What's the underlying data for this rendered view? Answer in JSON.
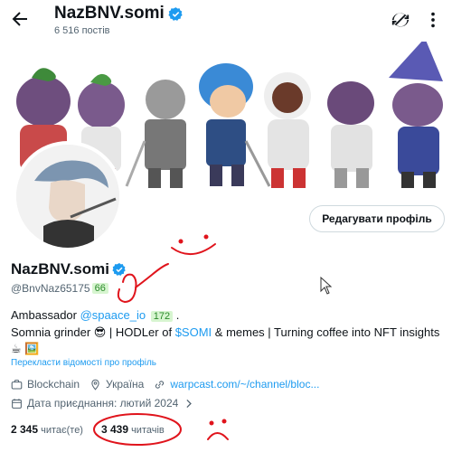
{
  "header": {
    "name": "NazBNV.somi",
    "post_count": "6 516 постів",
    "back_icon": "arrow-left-icon",
    "refresh_icon": "refresh-icon",
    "more_icon": "more-vertical-icon"
  },
  "profile": {
    "name": "NazBNV.somi",
    "handle": "@BnvNaz65175",
    "handle_badge": "66",
    "edit_button": "Редагувати профіль",
    "bio": {
      "role": "Ambassador",
      "mention": "@spaace_io",
      "mention_badge": "172",
      "mention_after": ".",
      "line2_start": "Somnia grinder 😎 | HODLer of",
      "cashtag": "$SOMI",
      "line2_end": "& memes | Turning coffee into NFT insights",
      "line3": "☕ 🖼️"
    },
    "translate_link": "Перекласти відомості про профіль",
    "category": "Blockchain",
    "location": "Україна",
    "website": "warpcast.com/~/channel/bloc...",
    "joined": "Дата приєднання: лютий 2024",
    "following_count": "2 345",
    "following_label": "читає(те)",
    "followers_count": "3 439",
    "followers_label": "читачів"
  },
  "colors": {
    "accent": "#1d9bf0",
    "text": "#0f1419",
    "muted": "#536471",
    "scribble": "#e0141c"
  }
}
